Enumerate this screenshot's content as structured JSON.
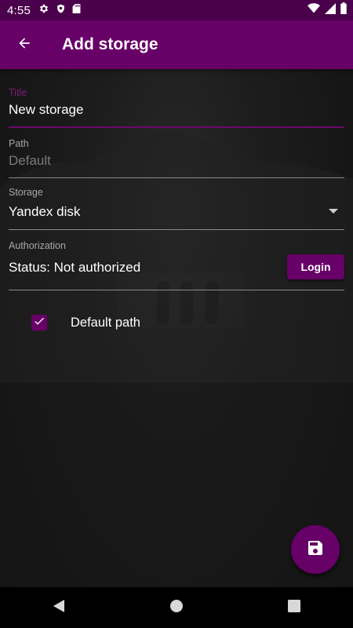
{
  "status_bar": {
    "time": "4:55",
    "left_icons": [
      "gear-icon",
      "shield-icon",
      "sd-card-icon"
    ],
    "right_icons": [
      "wifi-icon",
      "signal-icon",
      "battery-icon"
    ]
  },
  "app_bar": {
    "title": "Add storage",
    "back_icon": "arrow-back-icon"
  },
  "form": {
    "title": {
      "label": "Title",
      "value": "New storage"
    },
    "path": {
      "label": "Path",
      "placeholder": "Default"
    },
    "storage": {
      "label": "Storage",
      "selected": "Yandex disk"
    },
    "authorization": {
      "label": "Authorization",
      "status": "Status: Not authorized",
      "login_label": "Login"
    },
    "default_path": {
      "label": "Default path",
      "checked": true
    }
  },
  "fab": {
    "icon": "save-icon"
  },
  "nav_bar": {
    "icons": [
      "back-triangle-icon",
      "home-circle-icon",
      "recents-square-icon"
    ]
  },
  "colors": {
    "primary": "#670067",
    "status_bar": "#4a004a",
    "background": "#1a1a1a",
    "text": "#ffffff",
    "label": "#a8a8a8"
  }
}
